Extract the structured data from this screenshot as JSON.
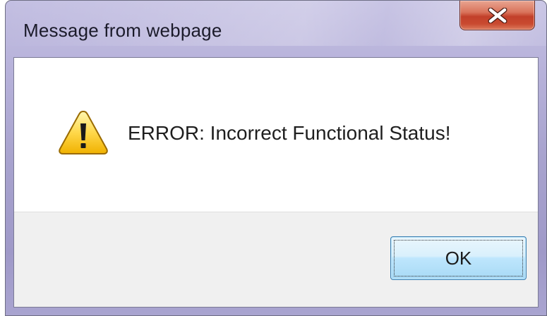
{
  "dialog": {
    "title": "Message from webpage",
    "message": "ERROR: Incorrect Functional Status!",
    "ok_label": "OK",
    "icons": {
      "close": "close-icon",
      "warning": "warning-icon"
    },
    "colors": {
      "close_button": "#c94a30",
      "ok_button_border": "#3c7fb1",
      "button_area_bg": "#f0f0f0"
    }
  }
}
